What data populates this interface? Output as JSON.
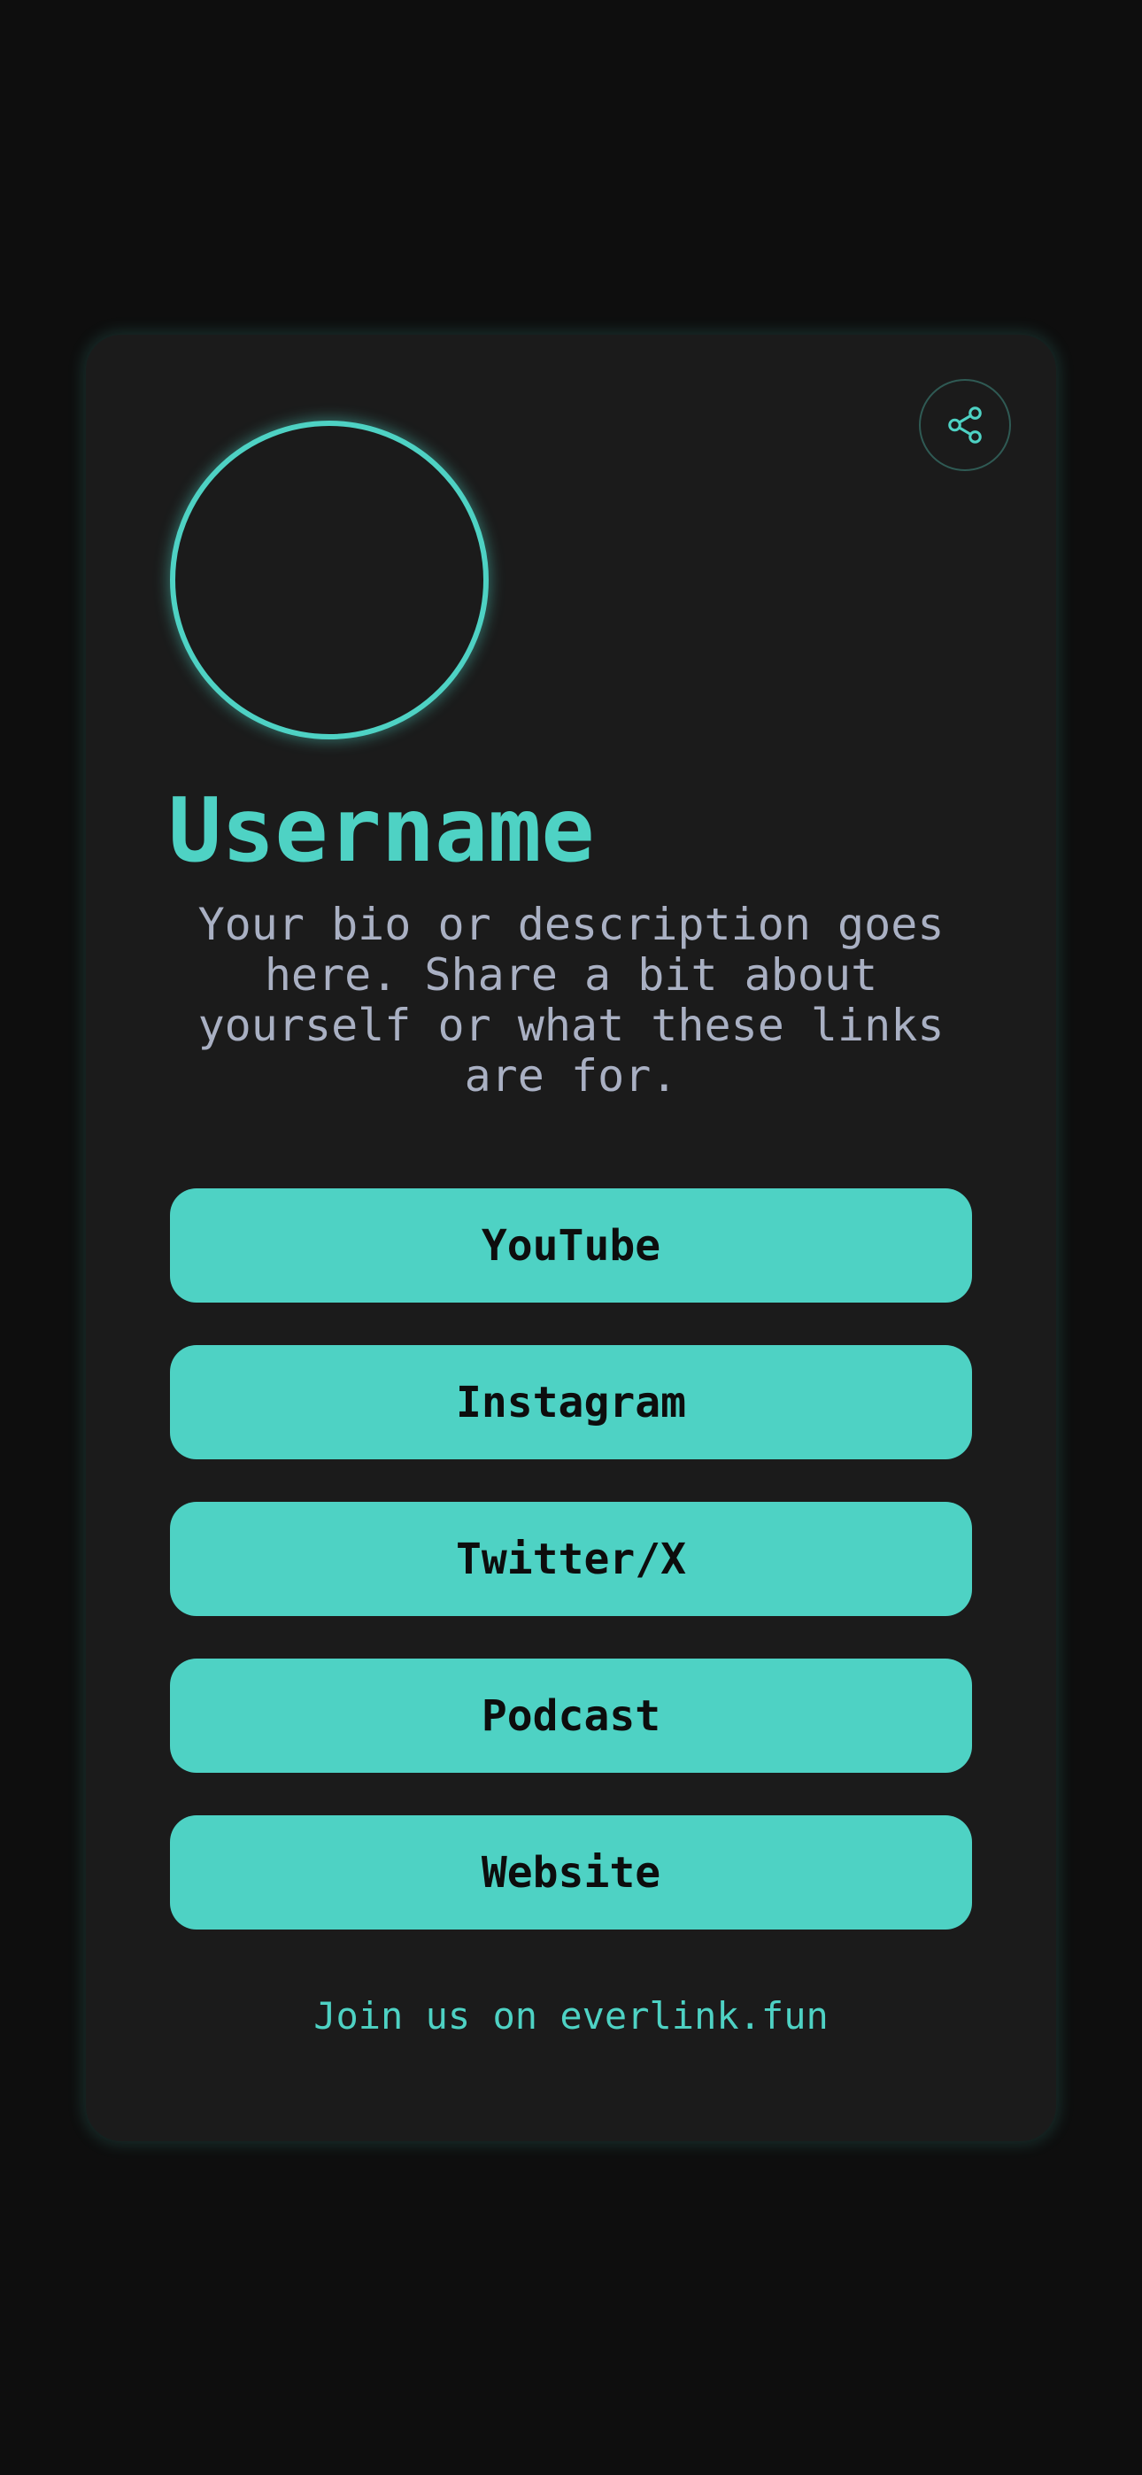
{
  "profile": {
    "username": "Username",
    "bio": "Your bio or description goes here. Share a bit about yourself or what these links are for."
  },
  "share": {
    "icon": "share-icon"
  },
  "links": [
    {
      "label": "YouTube"
    },
    {
      "label": "Instagram"
    },
    {
      "label": "Twitter/X"
    },
    {
      "label": "Podcast"
    },
    {
      "label": "Website"
    }
  ],
  "footer": {
    "text": "Join us on everlink.fun"
  },
  "colors": {
    "background": "#0e0e0e",
    "card": "#1b1b1b",
    "accent": "#4ed2c4",
    "bio_text": "#a9b0c3",
    "button_text": "#0d0d0d"
  }
}
